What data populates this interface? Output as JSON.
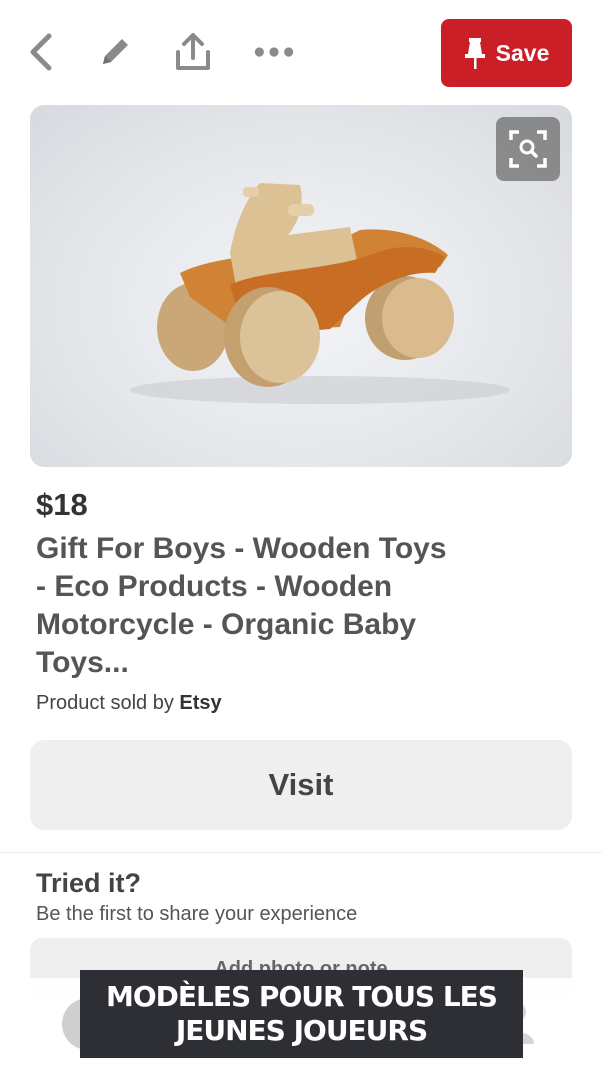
{
  "toolbar": {
    "back_icon": "chevron-left-icon",
    "edit_icon": "pencil-icon",
    "share_icon": "share-icon",
    "more_icon": "more-dots-icon",
    "save_icon": "pin-icon",
    "save_label": "Save",
    "save_color": "#cb1f27"
  },
  "photo": {
    "lens_icon": "visual-search-icon"
  },
  "product": {
    "price": "$18",
    "title": "Gift For Boys - Wooden Toys - Eco Products - Wooden Motorcycle - Organic Baby Toys...",
    "seller_prefix": "Product sold by",
    "seller_name": "Etsy"
  },
  "visit_label": "Visit",
  "tried": {
    "heading": "Tried it?",
    "subtitle": "Be the first to share your experience",
    "add_label": "Add photo or note"
  },
  "caption": {
    "line1": "MODÈLES POUR TOUS LES",
    "line2": "JEUNES JOUEURS"
  }
}
